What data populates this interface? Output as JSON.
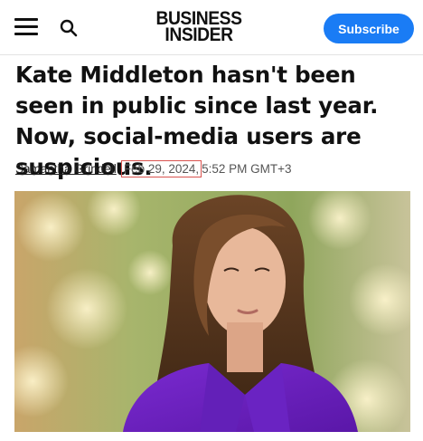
{
  "header": {
    "menu_icon": "hamburger-menu-icon",
    "search_icon": "search-icon",
    "logo_line1": "BUSINESS",
    "logo_line2": "INSIDER",
    "subscribe_label": "Subscribe",
    "accent_color": "#1a7cf5"
  },
  "article": {
    "headline": "Kate Middleton hasn't been seen in public since last year. Now, social-media users are suspicious.",
    "author": "Samantha Grindell",
    "date": "Feb 29, 2024,",
    "time": "5:52 PM GMT+3",
    "date_highlight_color": "#d9534f"
  },
  "hero_image": {
    "kind": "photo",
    "subject": "woman in purple coat"
  }
}
